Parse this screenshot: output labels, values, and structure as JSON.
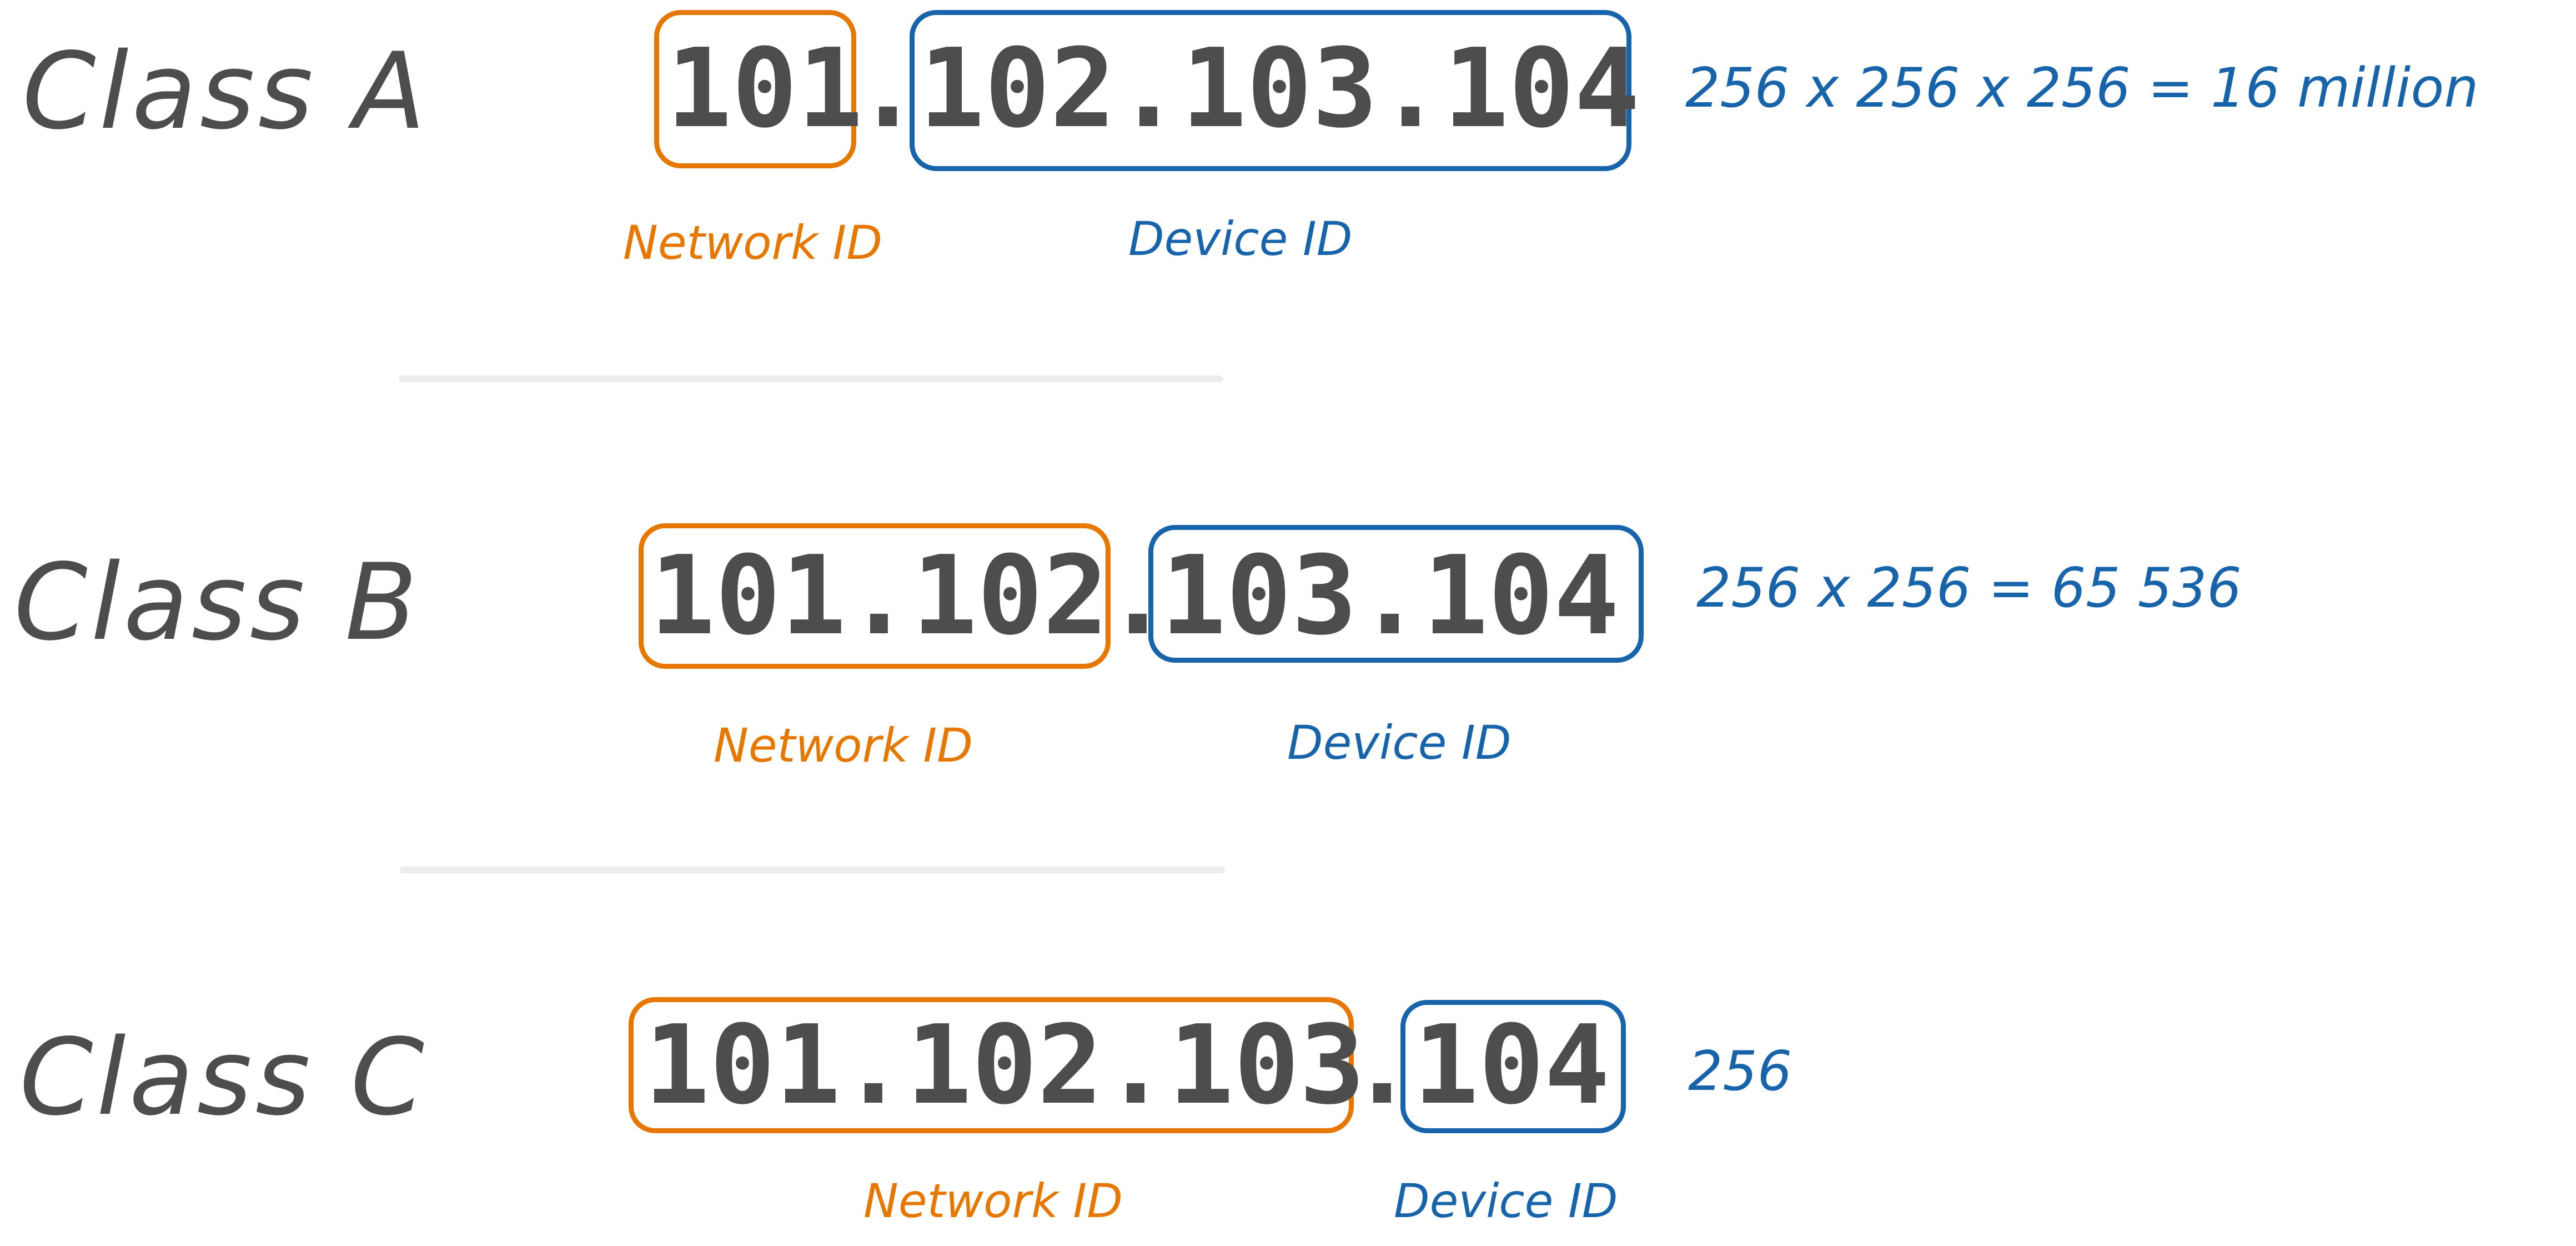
{
  "colors": {
    "text": "#4d4d4d",
    "network": "#e67700",
    "device": "#1864ab",
    "separator": "#ebecee",
    "background": "#ffffff"
  },
  "classes": [
    {
      "label": "Class A",
      "network_part": "101",
      "dot": ".",
      "device_part": "102.103.104",
      "network_caption": "Network ID",
      "device_caption": "Device ID",
      "formula": "256 x 256 x 256 = 16 million"
    },
    {
      "label": "Class B",
      "network_part": "101.102",
      "dot": ".",
      "device_part": "103.104",
      "network_caption": "Network ID",
      "device_caption": "Device ID",
      "formula": "256 x 256 = 65 536"
    },
    {
      "label": "Class C",
      "network_part": "101.102.103",
      "dot": ".",
      "device_part": "104",
      "network_caption": "Network ID",
      "device_caption": "Device ID",
      "formula": "256"
    }
  ]
}
